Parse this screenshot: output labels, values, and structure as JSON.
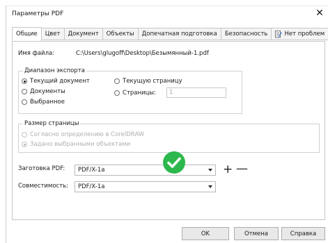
{
  "window": {
    "title": "Параметры PDF",
    "close_glyph": "✕"
  },
  "tabs": [
    {
      "label": "Общие",
      "active": true
    },
    {
      "label": "Цвет"
    },
    {
      "label": "Документ"
    },
    {
      "label": "Объекты"
    },
    {
      "label": "Допечатная подготовка"
    },
    {
      "label": "Безопасность"
    },
    {
      "label": "Нет проблем",
      "icon": "preflight-document-icon"
    }
  ],
  "general": {
    "filename_label": "Имя файла:",
    "filename_value": "C:\\Users\\glugoff\\Desktop\\Безымянный-1.pdf"
  },
  "export_range": {
    "legend": "Диапазон экспорта",
    "current_document": "Текущий документ",
    "documents": "Документы",
    "selected": "Выбранное",
    "current_page": "Текущую страницу",
    "pages": "Страницы:",
    "pages_value": "1",
    "selected_option": "current_document"
  },
  "page_size": {
    "legend": "Размер страницы",
    "as_in_coreldraw": "Согласно определению в CorelDRAW",
    "by_selected_objects": "Задано выбранными объектами",
    "selected_option": "by_selected_objects",
    "enabled": false
  },
  "preset": {
    "label": "Заготовка PDF:",
    "value": "PDF/X-1a",
    "add_glyph": "+",
    "remove_glyph": "—"
  },
  "compatibility": {
    "label": "Совместимость:",
    "value": "PDF/X-1a"
  },
  "buttons": {
    "ok": "OK",
    "cancel": "Отмена",
    "help": "Справка"
  },
  "colors": {
    "badge_green": "#2db84d",
    "panel_border": "#c6c6c6"
  }
}
